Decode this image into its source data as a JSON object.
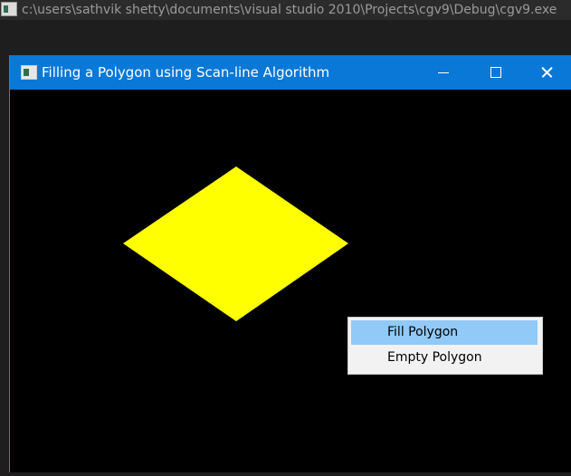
{
  "console": {
    "title": "c:\\users\\sathvik shetty\\documents\\visual studio 2010\\Projects\\cgv9\\Debug\\cgv9.exe"
  },
  "window": {
    "title": "Filling a Polygon using Scan-line Algorithm"
  },
  "polygon": {
    "fill_color": "#ffff00",
    "state": "filled"
  },
  "context_menu": {
    "items": [
      {
        "label": "Fill Polygon",
        "highlighted": true
      },
      {
        "label": "Empty Polygon",
        "highlighted": false
      }
    ]
  },
  "colors": {
    "titlebar": "#0a78d7",
    "canvas": "#000000",
    "menu_highlight": "#91c9f7"
  }
}
